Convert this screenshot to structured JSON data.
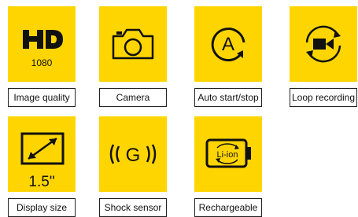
{
  "features": [
    {
      "icon": "hd-icon",
      "sub": "1080",
      "label": "Image quality"
    },
    {
      "icon": "camera-icon",
      "label": "Camera"
    },
    {
      "icon": "auto-start-stop-icon",
      "glyph": "A",
      "label": "Auto start/stop"
    },
    {
      "icon": "loop-recording-icon",
      "label": "Loop recording"
    },
    {
      "icon": "display-size-icon",
      "sub": "1.5\"",
      "label": "Display size"
    },
    {
      "icon": "shock-sensor-icon",
      "glyph": "G",
      "label": "Shock sensor"
    },
    {
      "icon": "battery-icon",
      "glyph": "Li-ion",
      "label": "Rechargeable"
    }
  ],
  "colors": {
    "tile": "#ffd500",
    "ink": "#111111"
  }
}
